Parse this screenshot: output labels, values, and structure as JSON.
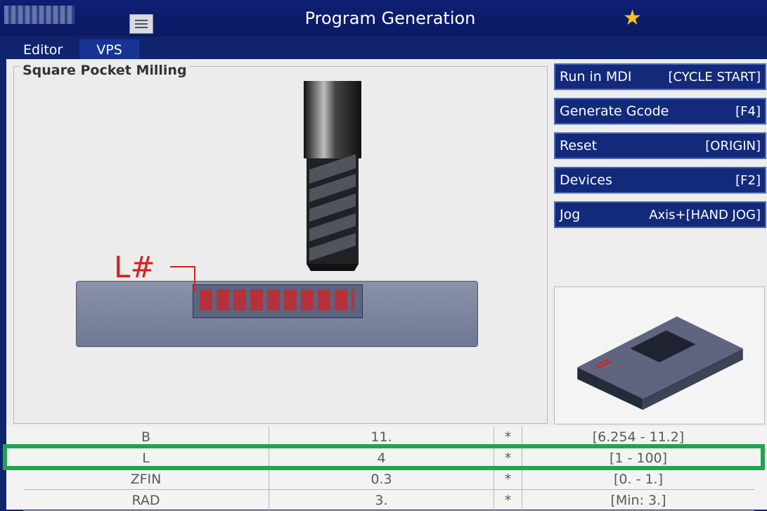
{
  "app": {
    "title": "Program Generation"
  },
  "tabs": [
    {
      "label": "Editor"
    },
    {
      "label": "VPS"
    }
  ],
  "main": {
    "panel_title": "Square Pocket Milling",
    "diagram_label": "L#"
  },
  "actions": [
    {
      "label": "Run in MDI",
      "shortcut": "[CYCLE START]"
    },
    {
      "label": "Generate Gcode",
      "shortcut": "[F4]"
    },
    {
      "label": "Reset",
      "shortcut": "[ORIGIN]"
    },
    {
      "label": "Devices",
      "shortcut": "[F2]"
    },
    {
      "label": "Jog",
      "shortcut": "Axis+[HAND JOG]"
    }
  ],
  "table": {
    "rows": [
      {
        "name": "B",
        "value": "11.",
        "flag": "*",
        "range": "[6.254 - 11.2]"
      },
      {
        "name": "L",
        "value": "4",
        "flag": "*",
        "range": "[1 - 100]"
      },
      {
        "name": "ZFIN",
        "value": "0.3",
        "flag": "*",
        "range": "[0. - 1.]"
      },
      {
        "name": "RAD",
        "value": "3.",
        "flag": "*",
        "range": "[Min: 3.]"
      }
    ]
  },
  "colors": {
    "highlight": "#1ea64c",
    "accent": "#132a7b",
    "star": "#f7c21a"
  }
}
